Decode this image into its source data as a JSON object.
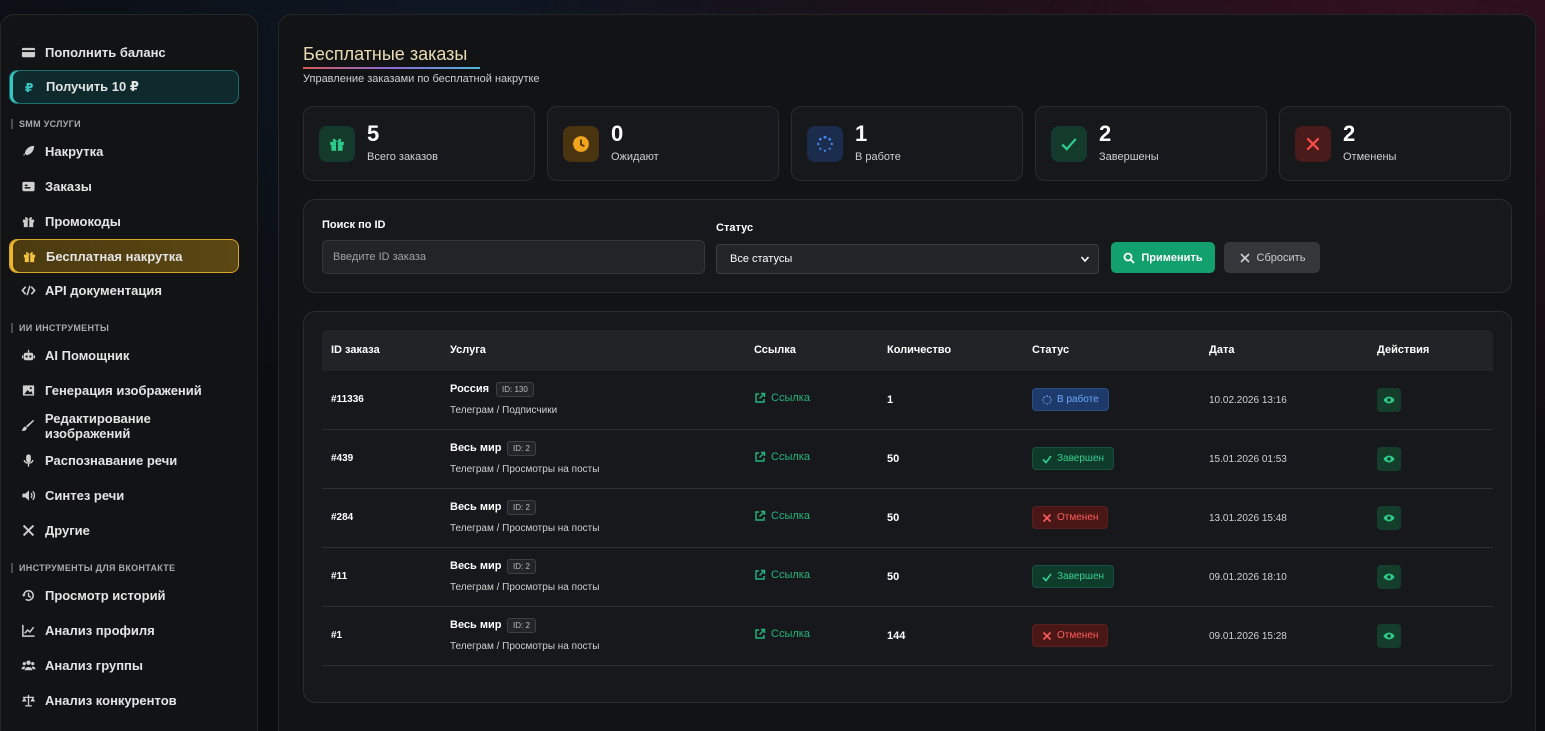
{
  "sidebar": {
    "top_items": [
      {
        "label": "Пополнить баланс",
        "icon": "card-icon"
      },
      {
        "label": "Получить 10 ₽",
        "icon": "ruble-icon"
      }
    ],
    "sections": [
      {
        "title": "SMM УСЛУГИ",
        "items": [
          {
            "label": "Накрутка",
            "icon": "rocket-icon"
          },
          {
            "label": "Заказы",
            "icon": "orders-icon"
          },
          {
            "label": "Промокоды",
            "icon": "gift-icon"
          },
          {
            "label": "Бесплатная накрутка",
            "icon": "gift-icon",
            "active": true
          },
          {
            "label": "API документация",
            "icon": "code-icon"
          }
        ]
      },
      {
        "title": "ИИ ИНСТРУМЕНТЫ",
        "items": [
          {
            "label": "AI Помощник",
            "icon": "robot-icon"
          },
          {
            "label": "Генерация изображений",
            "icon": "image-icon"
          },
          {
            "label": "Редактирование изображений",
            "icon": "brush-icon"
          },
          {
            "label": "Распознавание речи",
            "icon": "mic-icon"
          },
          {
            "label": "Синтез речи",
            "icon": "speaker-icon"
          },
          {
            "label": "Другие",
            "icon": "tools-icon"
          }
        ]
      },
      {
        "title": "ИНСТРУМЕНТЫ ДЛЯ ВКОНТАКТЕ",
        "items": [
          {
            "label": "Просмотр историй",
            "icon": "history-icon"
          },
          {
            "label": "Анализ профиля",
            "icon": "chart-icon"
          },
          {
            "label": "Анализ группы",
            "icon": "users-icon"
          },
          {
            "label": "Анализ конкурентов",
            "icon": "scales-icon"
          }
        ]
      }
    ]
  },
  "page": {
    "title": "Бесплатные заказы",
    "subtitle": "Управление заказами по бесплатной накрутке"
  },
  "stats": [
    {
      "value": "5",
      "label": "Всего заказов",
      "icon": "gift-icon",
      "color": "#2ecc8a",
      "bg": "#143a2c"
    },
    {
      "value": "0",
      "label": "Ожидают",
      "icon": "clock-icon",
      "color": "#f0a51c",
      "bg": "#4a3410"
    },
    {
      "value": "1",
      "label": "В работе",
      "icon": "spinner-icon",
      "color": "#3f86f0",
      "bg": "#1b2c4d"
    },
    {
      "value": "2",
      "label": "Завершены",
      "icon": "check-icon",
      "color": "#2ecc8a",
      "bg": "#143a2c"
    },
    {
      "value": "2",
      "label": "Отменены",
      "icon": "close-icon",
      "color": "#ff4d4d",
      "bg": "#4a1b1b"
    }
  ],
  "filters": {
    "search_label": "Поиск по ID",
    "search_placeholder": "Введите ID заказа",
    "status_label": "Статус",
    "status_value": "Все статусы",
    "apply_label": "Применить",
    "reset_label": "Сбросить"
  },
  "table": {
    "headers": [
      "ID заказа",
      "Услуга",
      "Ссылка",
      "Количество",
      "Статус",
      "Дата",
      "Действия"
    ],
    "rows": [
      {
        "id": "#11336",
        "service": "Россия",
        "service_id": "ID: 130",
        "category": "Телеграм / Подписчики",
        "link": "Ссылка",
        "qty": "1",
        "status": "В работе",
        "status_type": "work",
        "date": "10.02.2026 13:16"
      },
      {
        "id": "#439",
        "service": "Весь мир",
        "service_id": "ID: 2",
        "category": "Телеграм / Просмотры на посты",
        "link": "Ссылка",
        "qty": "50",
        "status": "Завершен",
        "status_type": "done",
        "date": "15.01.2026 01:53"
      },
      {
        "id": "#284",
        "service": "Весь мир",
        "service_id": "ID: 2",
        "category": "Телеграм / Просмотры на посты",
        "link": "Ссылка",
        "qty": "50",
        "status": "Отменен",
        "status_type": "cancel",
        "date": "13.01.2026 15:48"
      },
      {
        "id": "#11",
        "service": "Весь мир",
        "service_id": "ID: 2",
        "category": "Телеграм / Просмотры на посты",
        "link": "Ссылка",
        "qty": "50",
        "status": "Завершен",
        "status_type": "done",
        "date": "09.01.2026 18:10"
      },
      {
        "id": "#1",
        "service": "Весь мир",
        "service_id": "ID: 2",
        "category": "Телеграм / Просмотры на посты",
        "link": "Ссылка",
        "qty": "144",
        "status": "Отменен",
        "status_type": "cancel",
        "date": "09.01.2026 15:28"
      }
    ]
  }
}
